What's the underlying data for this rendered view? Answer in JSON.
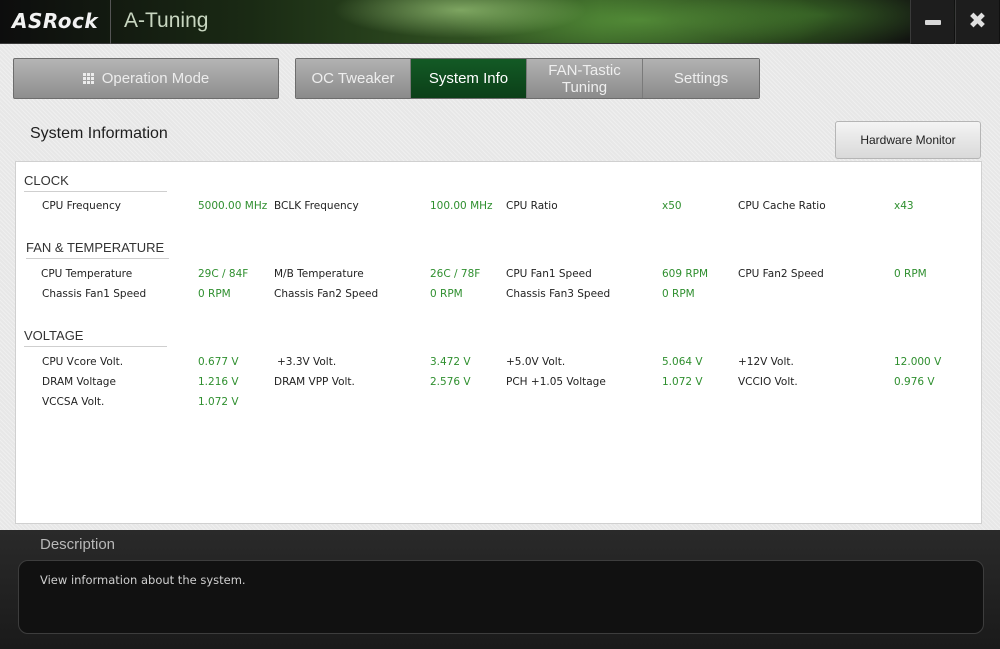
{
  "titlebar": {
    "brand": "ASRock",
    "app_title": "A-Tuning",
    "minimize_glyph": "",
    "close_glyph": "✖"
  },
  "nav": {
    "operation_mode": "Operation Mode",
    "tabs": [
      {
        "label": "OC Tweaker",
        "active": false
      },
      {
        "label": "System Info",
        "active": true
      },
      {
        "label": "FAN-Tastic Tuning",
        "active": false
      },
      {
        "label": "Settings",
        "active": false
      }
    ]
  },
  "page": {
    "title": "System Information",
    "hardware_monitor": "Hardware Monitor"
  },
  "sections": {
    "clock": {
      "heading": "CLOCK",
      "items": [
        {
          "label": "CPU Frequency",
          "value": "5000.00 MHz"
        },
        {
          "label": "BCLK Frequency",
          "value": "100.00 MHz"
        },
        {
          "label": "CPU Ratio",
          "value": "x50"
        },
        {
          "label": "CPU Cache Ratio",
          "value": "x43"
        }
      ]
    },
    "fan_temp": {
      "heading": "FAN & TEMPERATURE",
      "items": [
        {
          "label": "CPU Temperature",
          "value": "29C / 84F"
        },
        {
          "label": "M/B Temperature",
          "value": "26C / 78F"
        },
        {
          "label": "CPU Fan1 Speed",
          "value": "609 RPM"
        },
        {
          "label": "CPU Fan2 Speed",
          "value": "0 RPM"
        },
        {
          "label": "Chassis Fan1 Speed",
          "value": "0 RPM"
        },
        {
          "label": "Chassis Fan2 Speed",
          "value": "0 RPM"
        },
        {
          "label": "Chassis Fan3 Speed",
          "value": "0 RPM"
        }
      ]
    },
    "voltage": {
      "heading": "VOLTAGE",
      "items": [
        {
          "label": "CPU Vcore Volt.",
          "value": "0.677 V"
        },
        {
          "label": "+3.3V Volt.",
          "value": "3.472 V"
        },
        {
          "label": "+5.0V Volt.",
          "value": "5.064 V"
        },
        {
          "label": "+12V Volt.",
          "value": "12.000 V"
        },
        {
          "label": "DRAM Voltage",
          "value": "1.216 V"
        },
        {
          "label": "DRAM VPP Volt.",
          "value": "2.576 V"
        },
        {
          "label": "PCH +1.05 Voltage",
          "value": "1.072 V"
        },
        {
          "label": "VCCIO Volt.",
          "value": "0.976 V"
        },
        {
          "label": "VCCSA Volt.",
          "value": "1.072 V"
        }
      ]
    }
  },
  "description": {
    "title": "Description",
    "text": "View information about the system."
  },
  "colors": {
    "accent_green": "#0f4d1f",
    "value_green": "#2f8f2f"
  }
}
